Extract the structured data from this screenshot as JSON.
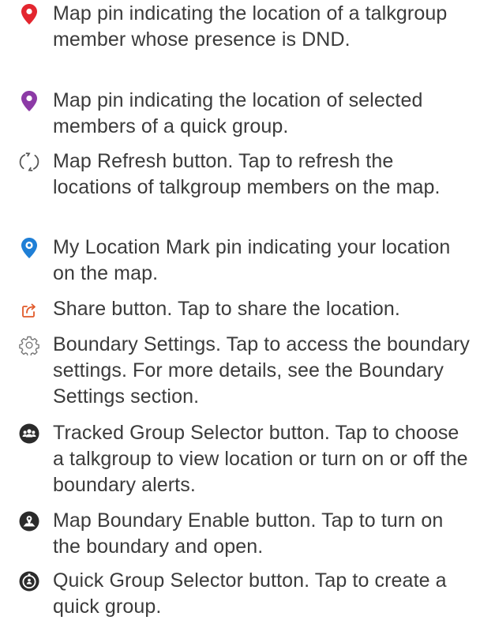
{
  "items": [
    {
      "icon": "red-map-pin-icon",
      "color": "#e3262f",
      "text": "Map pin indicating the location of a talkgroup member whose presence is DND."
    },
    {
      "icon": "purple-map-pin-icon",
      "color": "#8c3aa6",
      "text": "Map pin indicating the location of selected members of a quick group."
    },
    {
      "icon": "refresh-icon",
      "color": "#555555",
      "text": "Map Refresh button. Tap to refresh the locations of talkgroup members on the map."
    },
    {
      "icon": "my-location-pin-icon",
      "color": "#1f7fd6",
      "text": "My Location Mark pin indicating your location on the map."
    },
    {
      "icon": "share-icon",
      "color": "#e15a2a",
      "text": "Share button. Tap to share the location."
    },
    {
      "icon": "gear-icon",
      "color": "#777777",
      "text": "Boundary Settings. Tap to access the boundary settings. For more details, see the Boundary Settings section."
    },
    {
      "icon": "tracked-group-icon",
      "color": "#2b2b2b",
      "text": "Tracked Group Selector button. Tap to choose a talkgroup to view location or turn on or off the boundary alerts."
    },
    {
      "icon": "map-boundary-icon",
      "color": "#2b2b2b",
      "text": "Map Boundary Enable button. Tap to turn on the boundary and open."
    },
    {
      "icon": "quick-group-icon",
      "color": "#2b2b2b",
      "text": "Quick Group Selector button. Tap to create a quick group."
    }
  ]
}
